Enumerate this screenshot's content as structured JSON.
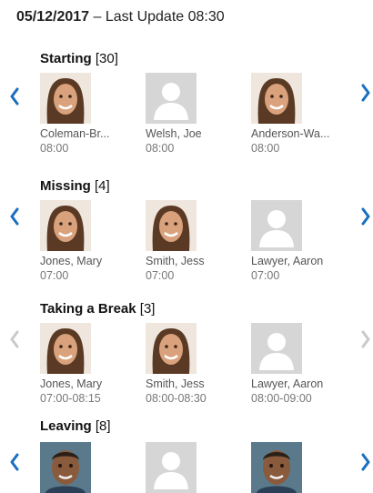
{
  "header": {
    "date": "05/12/2017",
    "separator": " – ",
    "update": "Last Update 08:30"
  },
  "colors": {
    "accent": "#1a6fc0",
    "disabled": "#c9c9c9",
    "placeholder_bg": "#d6d6d6"
  },
  "sections": [
    {
      "name": "Starting",
      "count": "[30]",
      "arrows_enabled": true,
      "people": [
        {
          "name": "Coleman-Br...",
          "time": "08:00",
          "photo": "woman-photo"
        },
        {
          "name": "Welsh, Joe",
          "time": "08:00",
          "photo": "placeholder"
        },
        {
          "name": "Anderson-Wa...",
          "time": "08:00",
          "photo": "woman-photo"
        }
      ]
    },
    {
      "name": "Missing",
      "count": "[4]",
      "arrows_enabled": true,
      "people": [
        {
          "name": "Jones, Mary",
          "time": "07:00",
          "photo": "woman-photo"
        },
        {
          "name": "Smith, Jess",
          "time": "07:00",
          "photo": "woman-photo"
        },
        {
          "name": "Lawyer, Aaron",
          "time": "07:00",
          "photo": "placeholder"
        }
      ]
    },
    {
      "name": "Taking a Break",
      "count": "[3]",
      "arrows_enabled": false,
      "people": [
        {
          "name": "Jones, Mary",
          "time": "07:00-08:15",
          "photo": "woman-photo"
        },
        {
          "name": "Smith, Jess",
          "time": "08:00-08:30",
          "photo": "woman-photo"
        },
        {
          "name": "Lawyer, Aaron",
          "time": "08:00-09:00",
          "photo": "placeholder"
        }
      ]
    },
    {
      "name": "Leaving",
      "count": "[8]",
      "arrows_enabled": true,
      "people": [
        {
          "name": "",
          "time": "",
          "photo": "man-photo"
        },
        {
          "name": "",
          "time": "",
          "photo": "placeholder"
        },
        {
          "name": "",
          "time": "",
          "photo": "man-photo"
        }
      ]
    }
  ]
}
